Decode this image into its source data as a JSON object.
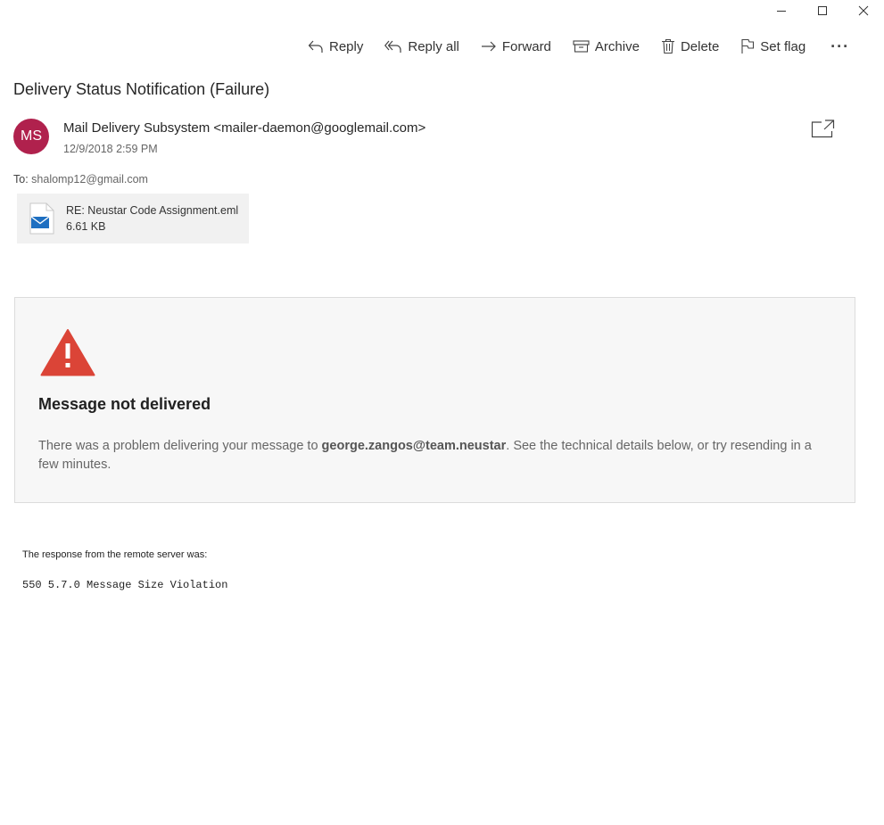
{
  "window": {
    "minimize_icon": "minimize-icon",
    "maximize_icon": "maximize-icon",
    "close_icon": "close-icon"
  },
  "toolbar": {
    "reply": "Reply",
    "reply_all": "Reply all",
    "forward": "Forward",
    "archive": "Archive",
    "delete": "Delete",
    "set_flag": "Set flag",
    "more": "···"
  },
  "message": {
    "subject": "Delivery Status Notification (Failure)",
    "avatar_initials": "MS",
    "avatar_color": "#b0214d",
    "sender": "Mail Delivery Subsystem <mailer-daemon@googlemail.com>",
    "date": "12/9/2018 2:59 PM",
    "to_label": "To:",
    "to_address": "shalomp12@gmail.com"
  },
  "attachment": {
    "name": "RE: Neustar Code Assignment.eml",
    "size": "6.61 KB"
  },
  "notice": {
    "heading": "Message not delivered",
    "body_pre": "There was a problem delivering your message to ",
    "recipient": "george.zangos@team.neustar",
    "body_post": ". See the technical details below, or try resending in a few minutes.",
    "warning_color": "#db4437"
  },
  "response": {
    "label": "The response from the remote server was:",
    "code": "550 5.7.0 Message Size Violation"
  }
}
